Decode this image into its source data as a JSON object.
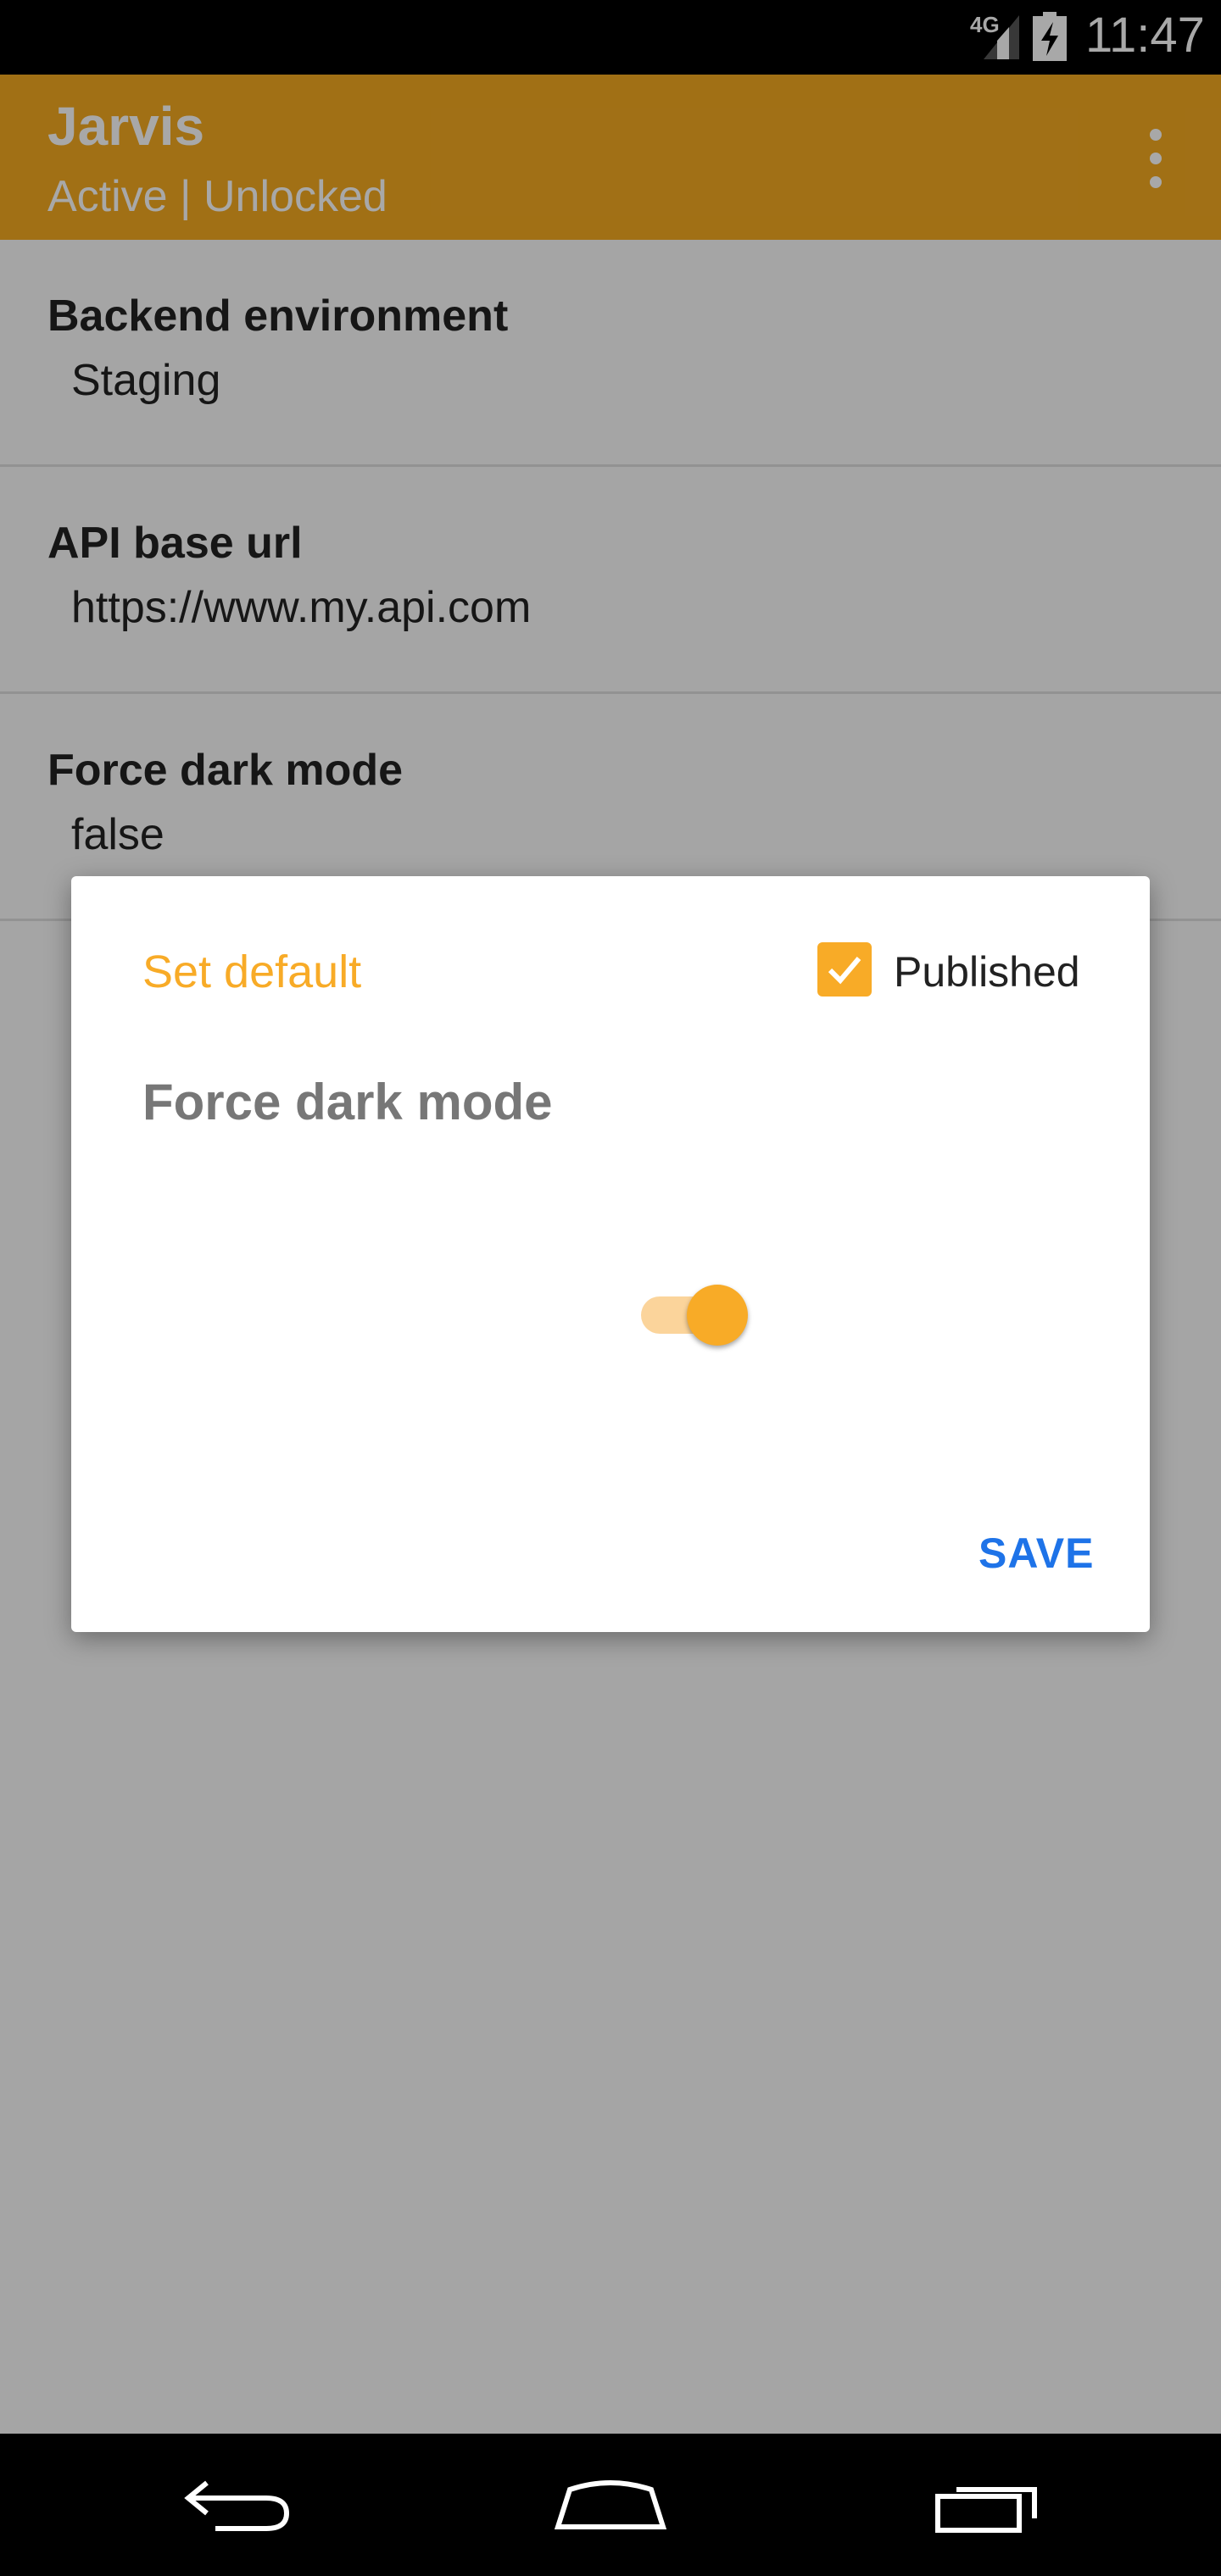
{
  "status_bar": {
    "network": "4G",
    "time": "11:47",
    "icons": [
      "signal-icon",
      "battery-charging-icon"
    ]
  },
  "app_bar": {
    "title": "Jarvis",
    "subtitle": "Active | Unlocked",
    "overflow_icon": "more-vert-icon"
  },
  "settings": [
    {
      "label": "Backend environment",
      "value": "Staging"
    },
    {
      "label": "API base url",
      "value": "https://www.my.api.com"
    },
    {
      "label": "Force dark mode",
      "value": "false"
    }
  ],
  "dialog": {
    "set_default_label": "Set default",
    "published_label": "Published",
    "published_checked": true,
    "title": "Force dark mode",
    "toggle_on": true,
    "save_label": "SAVE"
  },
  "nav_bar": {
    "icons": [
      "back-icon",
      "home-icon",
      "recents-icon"
    ]
  },
  "colors": {
    "accent": "#f8ab27",
    "app_bar": "#f4aa21",
    "save_button": "#1e73e8"
  }
}
